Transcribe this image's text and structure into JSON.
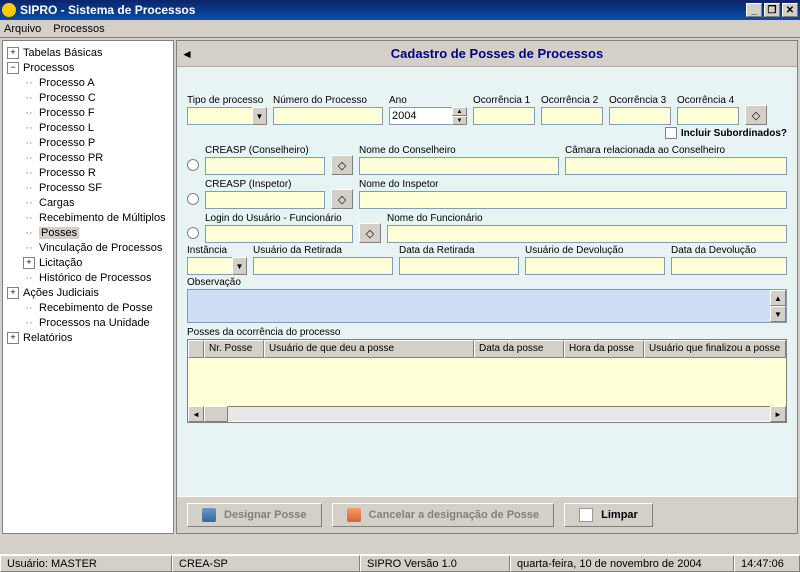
{
  "window": {
    "title": "SIPRO - Sistema de Processos"
  },
  "menubar": {
    "arquivo": "Arquivo",
    "processos": "Processos"
  },
  "tree": {
    "tabelas_basicas": "Tabelas Básicas",
    "processos": "Processos",
    "processo_a": "Processo A",
    "processo_c": "Processo C",
    "processo_f": "Processo F",
    "processo_l": "Processo L",
    "processo_p": "Processo P",
    "processo_pr": "Processo PR",
    "processo_r": "Processo R",
    "processo_sf": "Processo SF",
    "cargas": "Cargas",
    "recebimento_multiplos": "Recebimento de Múltiplos",
    "posses": "Posses",
    "vinculacao": "Vinculação de Processos",
    "licitacao": "Licitação",
    "historico": "Histórico de Processos",
    "acoes_judiciais": "Ações Judiciais",
    "recebimento_posse": "Recebimento de Posse",
    "processos_unidade": "Processos na Unidade",
    "relatorios": "Relatórios"
  },
  "content": {
    "title": "Cadastro de Posses de Processos",
    "labels": {
      "tipo_processo": "Tipo de processo",
      "numero_processo": "Número do Processo",
      "ano": "Ano",
      "ocorrencia1": "Ocorrência 1",
      "ocorrencia2": "Ocorrência 2",
      "ocorrencia3": "Ocorrência 3",
      "ocorrencia4": "Ocorrência 4",
      "incluir_sub": "Incluir Subordinados?",
      "creasp_cons": "CREASP (Conselheiro)",
      "nome_cons": "Nome do Conselheiro",
      "camara_cons": "Câmara relacionada ao Conselheiro",
      "creasp_insp": "CREASP (Inspetor)",
      "nome_insp": "Nome do Inspetor",
      "login_func": "Login do Usuário - Funcionário",
      "nome_func": "Nome do Funcionário",
      "instancia": "Instância",
      "usuario_retirada": "Usuário da Retirada",
      "data_retirada": "Data da Retirada",
      "usuario_devolucao": "Usuário de Devolução",
      "data_devolucao": "Data da Devolução",
      "observacao": "Observação",
      "grid_title": "Posses da ocorrência do processo"
    },
    "values": {
      "ano": "2004"
    },
    "grid_columns": {
      "nr_posse": "Nr. Posse",
      "usuario_deu": "Usuário de que deu a posse",
      "data_posse": "Data da posse",
      "hora_posse": "Hora da posse",
      "usuario_finalizou": "Usuário que finalizou a posse"
    },
    "buttons": {
      "designar": "Designar Posse",
      "cancelar": "Cancelar a designação de Posse",
      "limpar": "Limpar"
    }
  },
  "statusbar": {
    "usuario": "Usuário:  MASTER",
    "crea": "CREA-SP",
    "versao": "SIPRO Versão 1.0",
    "data": "quarta-feira, 10 de novembro de 2004",
    "hora": "14:47:06"
  }
}
